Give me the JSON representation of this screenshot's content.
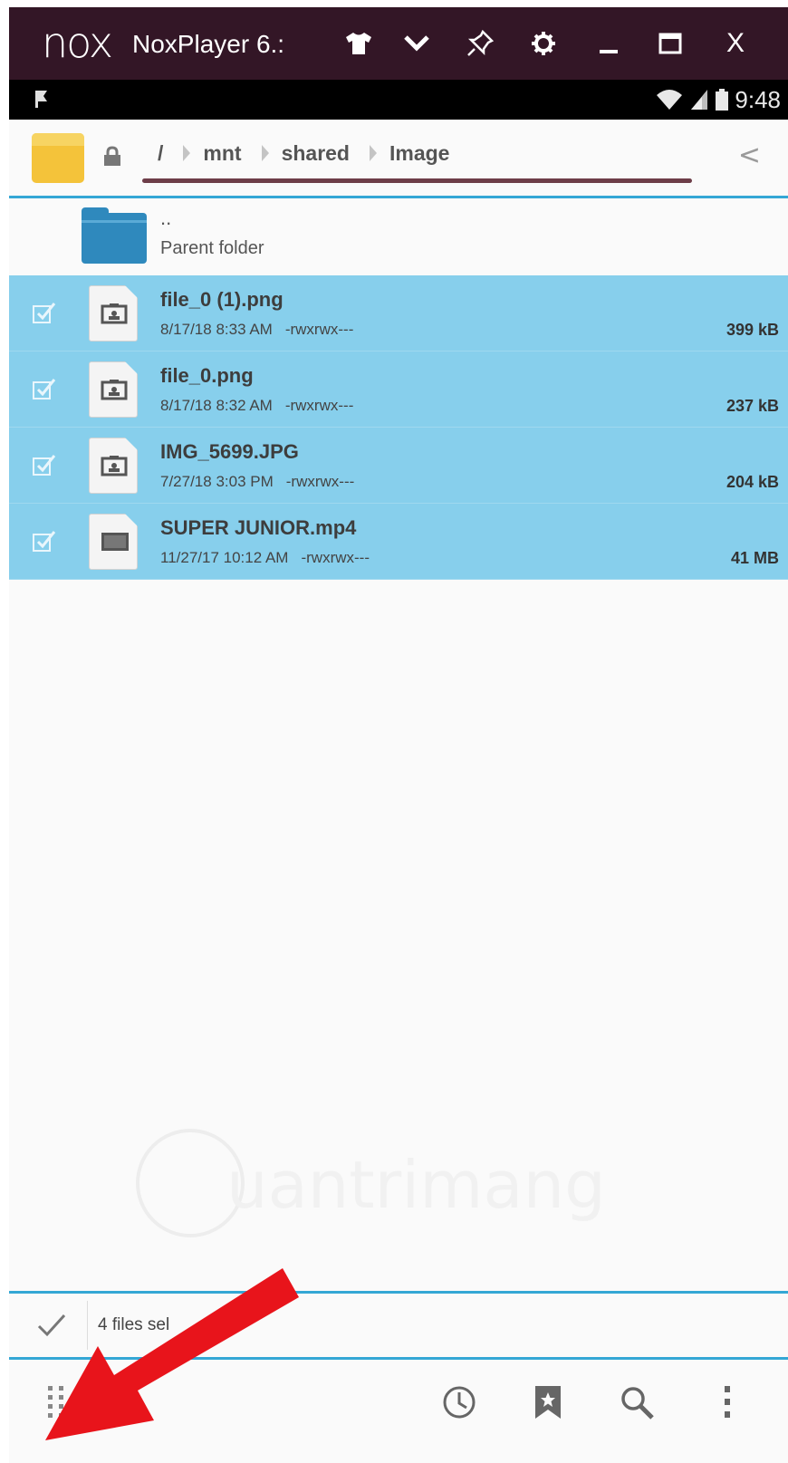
{
  "window": {
    "logo": "nox",
    "title": "NoxPlayer 6.:",
    "controls": [
      "shirt-icon",
      "chevron-down-icon",
      "pin-icon",
      "gear-icon",
      "minimize-icon",
      "maximize-icon",
      "close-icon"
    ],
    "close_glyph": "X"
  },
  "status_bar": {
    "time": "9:48"
  },
  "path": {
    "crumbs": [
      "/",
      "mnt",
      "shared",
      "Image"
    ],
    "back_glyph": "<"
  },
  "parent": {
    "dots": "..",
    "label": "Parent folder"
  },
  "files": [
    {
      "name": "file_0 (1).png",
      "date": "8/17/18 8:33 AM",
      "perms": "-rwxrwx---",
      "size": "399 kB",
      "type": "image",
      "selected": true
    },
    {
      "name": "file_0.png",
      "date": "8/17/18 8:32 AM",
      "perms": "-rwxrwx---",
      "size": "237 kB",
      "type": "image",
      "selected": true
    },
    {
      "name": "IMG_5699.JPG",
      "date": "7/27/18 3:03 PM",
      "perms": "-rwxrwx---",
      "size": "204 kB",
      "type": "image",
      "selected": true
    },
    {
      "name": "SUPER JUNIOR.mp4",
      "date": "11/27/17 10:12 AM",
      "perms": "-rwxrwx---",
      "size": "41 MB",
      "type": "video",
      "selected": true
    }
  ],
  "selection": {
    "text": "4 files sel"
  },
  "watermark": {
    "text": "uantrimang"
  },
  "toolbar": {
    "icons": [
      "apps-grid-icon",
      "clock-icon",
      "bookmark-icon",
      "search-icon",
      "more-vert-icon"
    ]
  },
  "colors": {
    "titlebar": "#331626",
    "selected_row": "#87cfec",
    "accent": "#34a7d5",
    "arrow": "#e8141b"
  }
}
